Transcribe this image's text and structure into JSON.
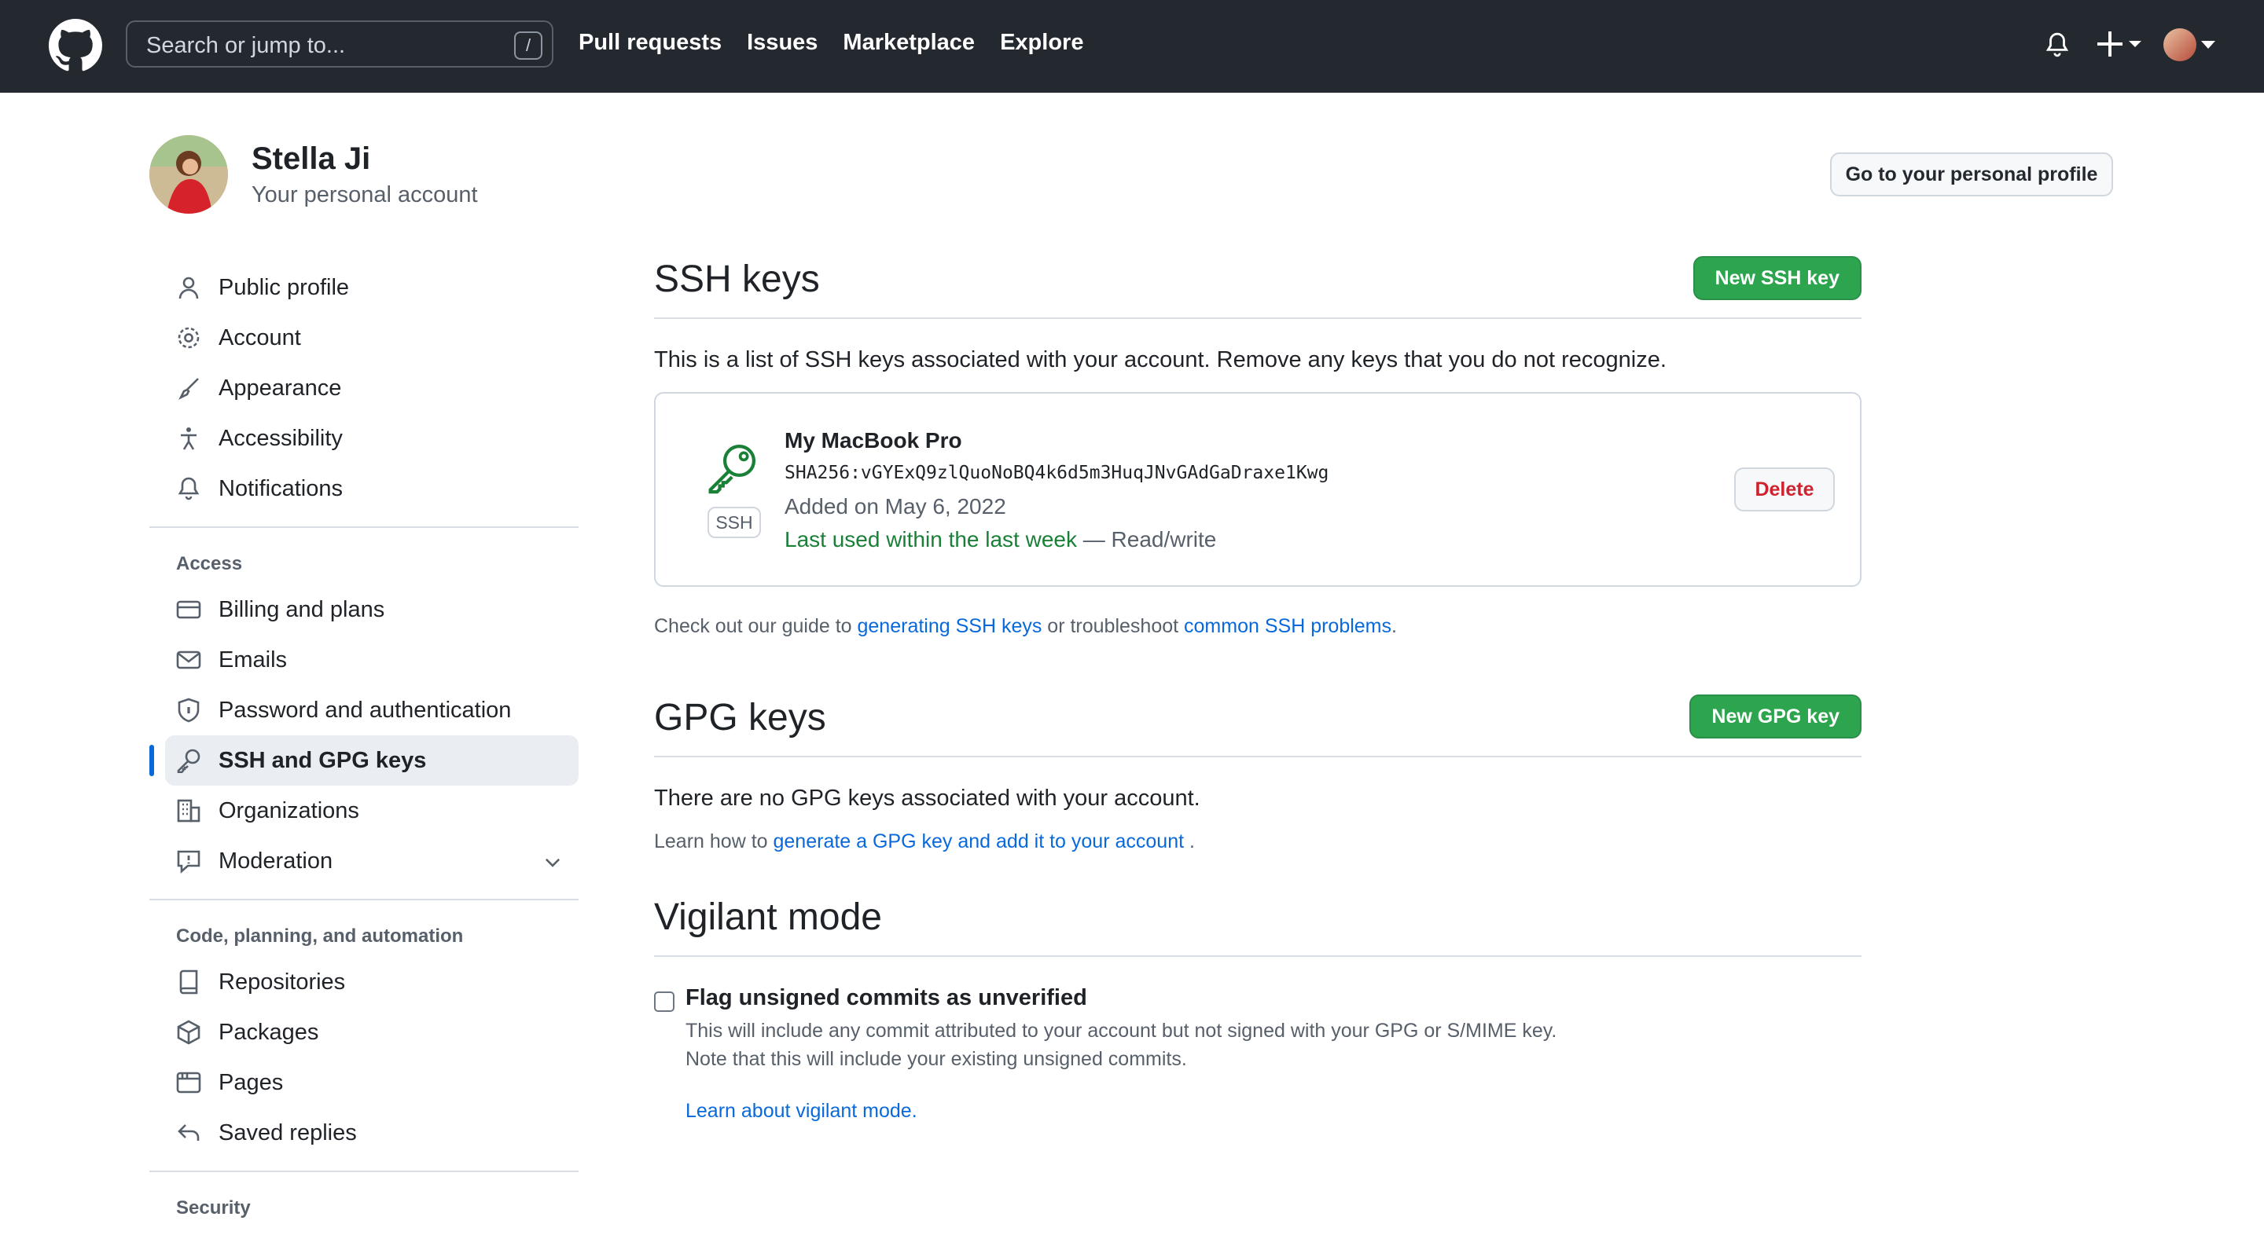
{
  "header": {
    "search_placeholder": "Search or jump to...",
    "search_shortcut": "/",
    "nav": [
      "Pull requests",
      "Issues",
      "Marketplace",
      "Explore"
    ]
  },
  "profile": {
    "name": "Stella Ji",
    "subtitle": "Your personal account",
    "go_button": "Go to your personal profile"
  },
  "sidebar": {
    "group1": [
      "Public profile",
      "Account",
      "Appearance",
      "Accessibility",
      "Notifications"
    ],
    "access_heading": "Access",
    "access": [
      "Billing and plans",
      "Emails",
      "Password and authentication",
      "SSH and GPG keys",
      "Organizations",
      "Moderation"
    ],
    "code_heading": "Code, planning, and automation",
    "code": [
      "Repositories",
      "Packages",
      "Pages",
      "Saved replies"
    ],
    "security_heading": "Security",
    "active": "SSH and GPG keys"
  },
  "ssh": {
    "title": "SSH keys",
    "new_button": "New SSH key",
    "lead": "This is a list of SSH keys associated with your account. Remove any keys that you do not recognize.",
    "key": {
      "badge": "SSH",
      "name": "My MacBook Pro",
      "fingerprint": "SHA256:vGYExQ9zlQuoNoBQ4k6d5m3HuqJNvGAdGaDraxe1Kwg",
      "added": "Added on May 6, 2022",
      "last_used": "Last used within the last week",
      "access": " — Read/write",
      "delete_button": "Delete"
    },
    "help_prefix": "Check out our guide to ",
    "help_link1": "generating SSH keys",
    "help_mid": " or troubleshoot ",
    "help_link2": "common SSH problems",
    "help_suffix": "."
  },
  "gpg": {
    "title": "GPG keys",
    "new_button": "New GPG key",
    "lead": "There are no GPG keys associated with your account.",
    "help_prefix": "Learn how to ",
    "help_link": "generate a GPG key and add it to your account",
    "help_suffix": " ."
  },
  "vigilant": {
    "title": "Vigilant mode",
    "checkbox_label": "Flag unsigned commits as unverified",
    "desc1": "This will include any commit attributed to your account but not signed with your GPG or S/MIME key.",
    "desc2": "Note that this will include your existing unsigned commits.",
    "link": "Learn about vigilant mode."
  },
  "colors": {
    "header_bg": "#24292f",
    "accent_blue": "#0969da",
    "green_button": "#2da44e",
    "danger": "#cf222e",
    "success_text": "#1a7f37"
  }
}
